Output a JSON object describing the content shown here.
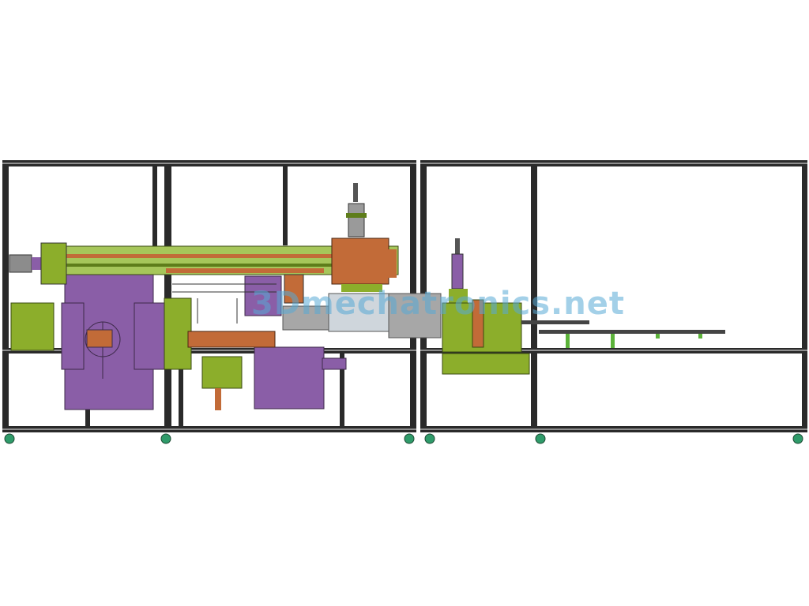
{
  "drawing": {
    "description_role": "CAD side elevation of an automated assembly machine",
    "watermark_text": "3Dmechatronics.net",
    "colors": {
      "background": "#ffffff",
      "frame": "#2a2a2a",
      "frame_highlight": "#8d8d8d",
      "guard_purple": "#8a5ea7",
      "module_green": "#8cae2b",
      "module_green_dark": "#5e7d1a",
      "copper": "#c26b38",
      "steel_grey": "#a7a7a7",
      "light_steel": "#cfd6dc",
      "caster": "#2f9b6a",
      "watermark": "#58aad6"
    },
    "icons": [
      "caster-wheel-icon",
      "pneumatic-cylinder-icon",
      "servo-motor-icon"
    ]
  }
}
